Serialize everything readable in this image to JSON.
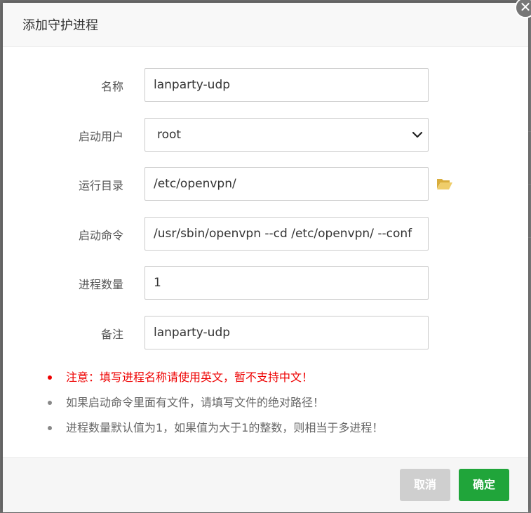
{
  "dialog": {
    "title": "添加守护进程",
    "close_glyph": "✕"
  },
  "form": {
    "name": {
      "label": "名称",
      "value": "lanparty-udp"
    },
    "user": {
      "label": "启动用户",
      "value": "root"
    },
    "dir": {
      "label": "运行目录",
      "value": "/etc/openvpn/"
    },
    "cmd": {
      "label": "启动命令",
      "value": "/usr/sbin/openvpn --cd /etc/openvpn/ --conf"
    },
    "procs": {
      "label": "进程数量",
      "value": "1"
    },
    "note": {
      "label": "备注",
      "value": "lanparty-udp"
    }
  },
  "notes": [
    "注意：填写进程名称请使用英文，暂不支持中文！",
    "如果启动命令里面有文件，请填写文件的绝对路径！",
    "进程数量默认值为1，如果值为大于1的整数，则相当于多进程！"
  ],
  "footer": {
    "cancel_label": "取消",
    "confirm_label": "确定"
  },
  "colors": {
    "accent_green": "#20a53a",
    "warning_red": "#e00000",
    "folder_yellow": "#e8c15a"
  },
  "icons": [
    "close-icon",
    "chevron-down-icon",
    "folder-open-icon"
  ]
}
